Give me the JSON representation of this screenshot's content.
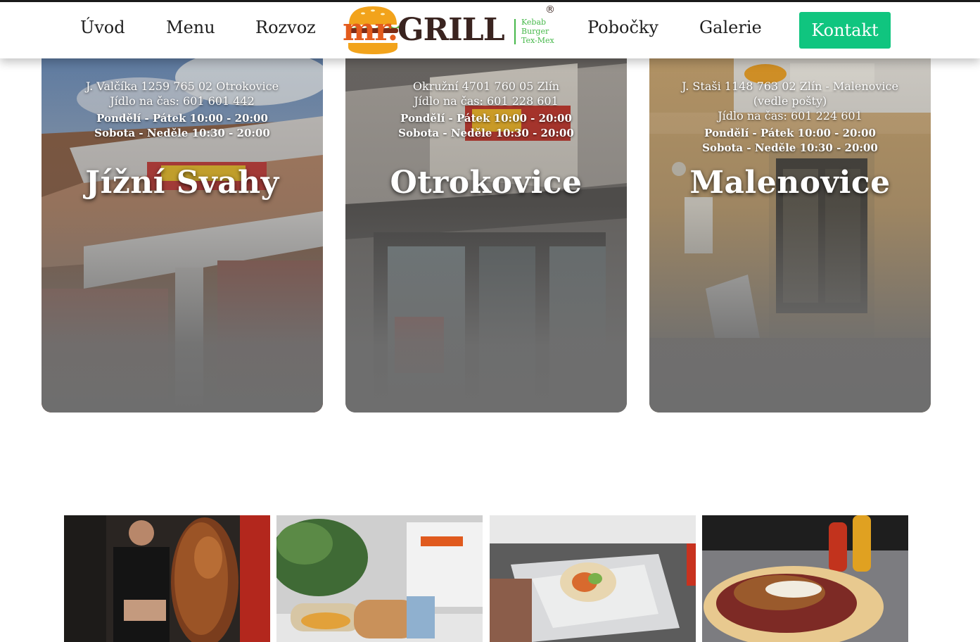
{
  "header": {
    "nav_left": [
      {
        "label": "Úvod"
      },
      {
        "label": "Menu"
      },
      {
        "label": "Rozvoz"
      }
    ],
    "logo": {
      "text_mr": "mr.",
      "text_grill": "GRILL",
      "tagline": [
        "Kebab",
        "Burger",
        "Tex-Mex"
      ],
      "registered_mark": "®",
      "icon": "burger-logo-icon"
    },
    "nav_right": [
      {
        "label": "Pobočky"
      },
      {
        "label": "Galerie"
      }
    ],
    "cta_label": "Kontakt"
  },
  "branches": [
    {
      "name": "Jížní Svahy",
      "address_lines": [
        "J. Valčíka 1259 765 02 Otrokovice"
      ],
      "phone": "Jídlo na čas: 601 601 442",
      "hours_weekday": "Pondělí - Pátek 10:00 - 20:00",
      "hours_weekend": "Sobota - Neděle 10:30 - 20:00"
    },
    {
      "name": "Otrokovice",
      "address_lines": [
        "Okružní 4701 760 05 Zlín"
      ],
      "phone": "Jídlo na čas: 601 228 601",
      "hours_weekday": "Pondělí - Pátek 10:00 - 20:00",
      "hours_weekend": "Sobota - Neděle 10:30 - 20:00"
    },
    {
      "name": "Malenovice",
      "address_lines": [
        "J. Staši 1148 763 02 Zlín - Malenovice",
        "(vedle pošty)"
      ],
      "phone": "Jídlo na čas: 601 224 601",
      "hours_weekday": "Pondělí - Pátek 10:00 - 20:00",
      "hours_weekend": "Sobota - Neděle 10:30 - 20:00"
    }
  ],
  "colors": {
    "accent_green": "#10c57f",
    "logo_orange": "#e35b1c",
    "logo_brown": "#3a2420",
    "logo_green": "#46b84a",
    "card_fade": "#6e6e6e"
  }
}
